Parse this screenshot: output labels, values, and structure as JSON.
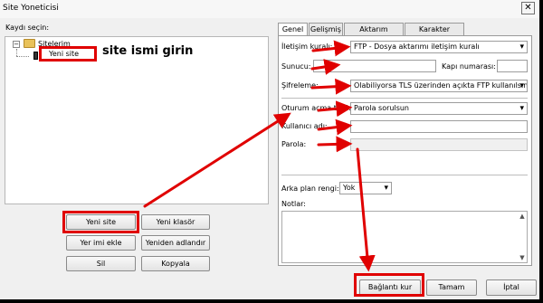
{
  "window": {
    "title": "Site Yoneticisi",
    "close_glyph": "✕"
  },
  "left": {
    "tree_label": "Kaydı seçin:",
    "tree_toggle": "−",
    "tree_root": "Sitelerim",
    "tree_child": "Yeni site",
    "annotation": "site ismi girin",
    "buttons": {
      "new_site": "Yeni site",
      "new_folder": "Yeni klasör",
      "new_bookmark": "Yer imi ekle",
      "rename": "Yeniden adlandır",
      "delete": "Sil",
      "copy": "Kopyala"
    }
  },
  "tabs": [
    "Genel",
    "Gelişmiş",
    "Aktarım Ayarları",
    "Karakter kümesi"
  ],
  "general": {
    "protocol_label": "İletişim kuralı:",
    "protocol_value": "FTP - Dosya aktarımı iletişim kuralı",
    "host_label": "Sunucu:",
    "host_value": "",
    "port_label": "Kapı numarası:",
    "port_value": "",
    "encryption_label": "Şifreleme:",
    "encryption_value": "Olabiliyorsa TLS üzerinden açıkta FTP kullanılsın",
    "logon_label": "Oturum açma türü:",
    "logon_value": "Parola sorulsun",
    "user_label": "Kullanıcı adı:",
    "user_value": "",
    "password_label": "Parola:",
    "password_value": "",
    "bg_color_label": "Arka plan rengi:",
    "bg_color_value": "Yok",
    "notes_label": "Notlar:"
  },
  "bottom": {
    "connect": "Bağlantı kur",
    "ok": "Tamam",
    "cancel": "İptal"
  },
  "annotation_color": "#e00000",
  "icons": [
    "folder-icon",
    "site-icon",
    "close-icon",
    "chevron-down-icon",
    "arrow-icon"
  ]
}
